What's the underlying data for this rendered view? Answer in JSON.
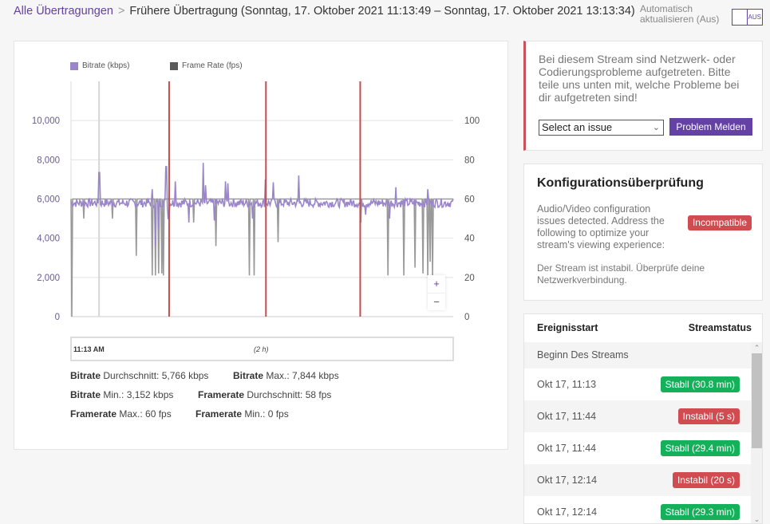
{
  "header": {
    "breadcrumb_link": "Alle Übertragungen",
    "breadcrumb_separator": ">",
    "breadcrumb_current": "Frühere Übertragung (Sonntag, 17. Oktober 2021 11:13:49 – Sonntag, 17. Oktober 2021 13:13:34)",
    "auto_refresh_line1": "Automatisch",
    "auto_refresh_line2": "aktualisieren (Aus)",
    "toggle_label": "AUS",
    "toggle_state": "off"
  },
  "colors": {
    "accent": "#6441a4",
    "bitrate": "#9b86cc",
    "framerate": "#999999",
    "event_marker": "#c0504d",
    "stable": "#15b05a",
    "unstable": "#d04c51"
  },
  "chart_data": {
    "type": "line",
    "legend": [
      {
        "label": "Bitrate (kbps)",
        "color": "#9b86cc"
      },
      {
        "label": "Frame Rate (fps)",
        "color": "#5a5a5a"
      }
    ],
    "legend_position": "top-left",
    "y_left": {
      "label": "Bitrate (kbps)",
      "ticks": [
        "0",
        "2,000",
        "4,000",
        "6,000",
        "8,000",
        "10,000"
      ],
      "range": [
        0,
        12000
      ]
    },
    "y_right": {
      "label": "Frame Rate (fps)",
      "ticks": [
        "0",
        "20",
        "40",
        "60",
        "80",
        "100"
      ],
      "range": [
        0,
        120
      ]
    },
    "x_range_minutes": [
      0,
      120
    ],
    "grid": true,
    "x_start_label": "11:13 AM",
    "duration_label": "(2 h)",
    "event_markers_minutes": [
      30.8,
      61.2,
      90.8
    ],
    "cursor_line_minutes": 8.8,
    "bitrate_series": {
      "name": "Bitrate (kbps)",
      "baseline": 5800,
      "spikes": [
        [
          8.8,
          7350
        ],
        [
          25.5,
          6500
        ],
        [
          29.8,
          7650
        ],
        [
          32.8,
          6900
        ],
        [
          41.5,
          7844
        ],
        [
          42.3,
          6700
        ],
        [
          48.5,
          6900
        ],
        [
          49.2,
          6800
        ],
        [
          61.0,
          7000
        ],
        [
          63.5,
          6850
        ],
        [
          71.5,
          7200
        ],
        [
          102.0,
          6600
        ],
        [
          112.0,
          6500
        ]
      ],
      "dips": [
        [
          26.5,
          3600
        ],
        [
          27.5,
          4500
        ],
        [
          30.6,
          5000
        ],
        [
          37.0,
          4800
        ],
        [
          45.0,
          4900
        ],
        [
          57.0,
          5000
        ],
        [
          92.5,
          5200
        ],
        [
          100.0,
          5000
        ]
      ]
    },
    "framerate_series": {
      "name": "Frame Rate (fps)",
      "baseline": 60,
      "drops": [
        [
          0.2,
          0
        ],
        [
          4.0,
          50
        ],
        [
          13.0,
          50
        ],
        [
          20.5,
          31
        ],
        [
          25.5,
          21
        ],
        [
          26.5,
          21
        ],
        [
          27.5,
          22
        ],
        [
          28.5,
          22
        ],
        [
          29.0,
          21
        ],
        [
          38.5,
          48
        ],
        [
          45.5,
          36
        ],
        [
          56.0,
          21
        ],
        [
          57.5,
          21
        ],
        [
          65.0,
          38
        ],
        [
          91.0,
          48
        ],
        [
          99.5,
          21
        ],
        [
          104.5,
          21
        ],
        [
          108.0,
          25
        ],
        [
          110.5,
          22
        ],
        [
          112.0,
          21
        ],
        [
          112.8,
          28
        ],
        [
          113.5,
          21
        ]
      ]
    },
    "summary": {
      "bitrate_avg": "5,766 kbps",
      "bitrate_max": "7,844 kbps",
      "bitrate_min": "3,152 kbps",
      "framerate_avg": "58 fps",
      "framerate_max": "60 fps",
      "framerate_min": "0 fps"
    }
  },
  "chart_controls": {
    "zoom_in": "+",
    "zoom_out": "−"
  },
  "stats": {
    "bitrate_avg_label": "Bitrate",
    "bitrate_avg_rest": " Durchschnitt: 5,766 kbps",
    "bitrate_max_label": "Bitrate",
    "bitrate_max_rest": " Max.: 7,844 kbps",
    "bitrate_min_label": "Bitrate",
    "bitrate_min_rest": " Min.: 3,152 kbps",
    "framerate_avg_label": "Framerate",
    "framerate_avg_rest": " Durchschnitt: 58 fps",
    "framerate_max_label": "Framerate",
    "framerate_max_rest": " Max.: 60 fps",
    "framerate_min_label": "Framerate",
    "framerate_min_rest": " Min.: 0 fps"
  },
  "alert": {
    "text": "Bei diesem Stream sind Netzwerk- oder Codierungsprobleme aufgetreten. Bitte teile uns unten mit, welche Probleme bei dir aufgetreten sind!",
    "select_value": "Select an issue",
    "report_button": "Problem Melden"
  },
  "config": {
    "title": "Konfigurationsüberprüfung",
    "description": "Audio/Video configuration issues detected. Address the following to optimize your stream's viewing experience:",
    "badge": "Incompatible",
    "note": "Der Stream ist instabil. Überprüfe deine Netzwerkverbindung."
  },
  "events": {
    "col_start": "Ereignisstart",
    "col_status": "Streamstatus",
    "rows": [
      {
        "time": "Beginn Des Streams",
        "status": "",
        "kind": "none"
      },
      {
        "time": "Okt 17, 11:13",
        "status": "Stabil (30.8 min)",
        "kind": "stable"
      },
      {
        "time": "Okt 17, 11:44",
        "status": "Instabil (5 s)",
        "kind": "unstable"
      },
      {
        "time": "Okt 17, 11:44",
        "status": "Stabil (29.4 min)",
        "kind": "stable"
      },
      {
        "time": "Okt 17, 12:14",
        "status": "Instabil (20 s)",
        "kind": "unstable"
      },
      {
        "time": "Okt 17, 12:14",
        "status": "Stabil (29.3 min)",
        "kind": "stable"
      }
    ]
  }
}
